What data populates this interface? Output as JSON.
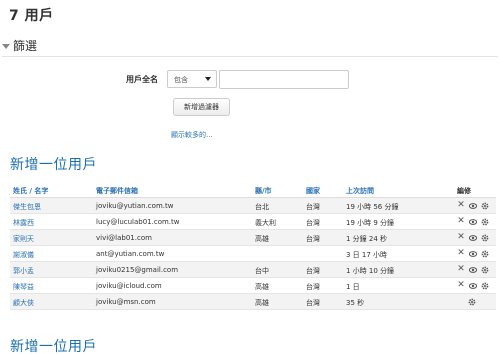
{
  "page": {
    "title": "7 用戶"
  },
  "filter": {
    "title": "篩選",
    "field_label": "用戶全名",
    "operator": "包含",
    "value": "",
    "add_button": "新增過濾器",
    "show_more": "顯示較多的..."
  },
  "heading_top": "新增一位用戶",
  "heading_bottom": "新增一位用戶",
  "table": {
    "columns": {
      "name": "姓氏 / 名字",
      "email": "電子郵件信箱",
      "city": "縣/市",
      "country": "國家",
      "last_access": "上次訪問",
      "edit": "編修"
    },
    "rows": [
      {
        "name": "傑生包恩",
        "email": "joviku@yutian.com.tw",
        "city": "台北",
        "country": "台灣",
        "last_access": "19 小時 56 分鐘"
      },
      {
        "name": "林露西",
        "email": "lucy@luculab01.com.tw",
        "city": "義大利",
        "country": "台灣",
        "last_access": "19 小時 9 分鐘"
      },
      {
        "name": "家則天",
        "email": "vivi@lab01.com",
        "city": "高雄",
        "country": "台灣",
        "last_access": "1 分鐘 24 秒"
      },
      {
        "name": "謝淑儀",
        "email": "ant@yutian.com.tw",
        "city": "",
        "country": "",
        "last_access": "3 日 17 小時"
      },
      {
        "name": "郭小孟",
        "email": "joviku0215@gmail.com",
        "city": "台中",
        "country": "台灣",
        "last_access": "1 小時 10 分鐘"
      },
      {
        "name": "陳琴益",
        "email": "joviku@icloud.com",
        "city": "高雄",
        "country": "台灣",
        "last_access": "1 日"
      },
      {
        "name": "顧大俠",
        "email": "joviku@msn.com",
        "city": "高雄",
        "country": "台灣",
        "last_access": "35 秒"
      }
    ]
  }
}
